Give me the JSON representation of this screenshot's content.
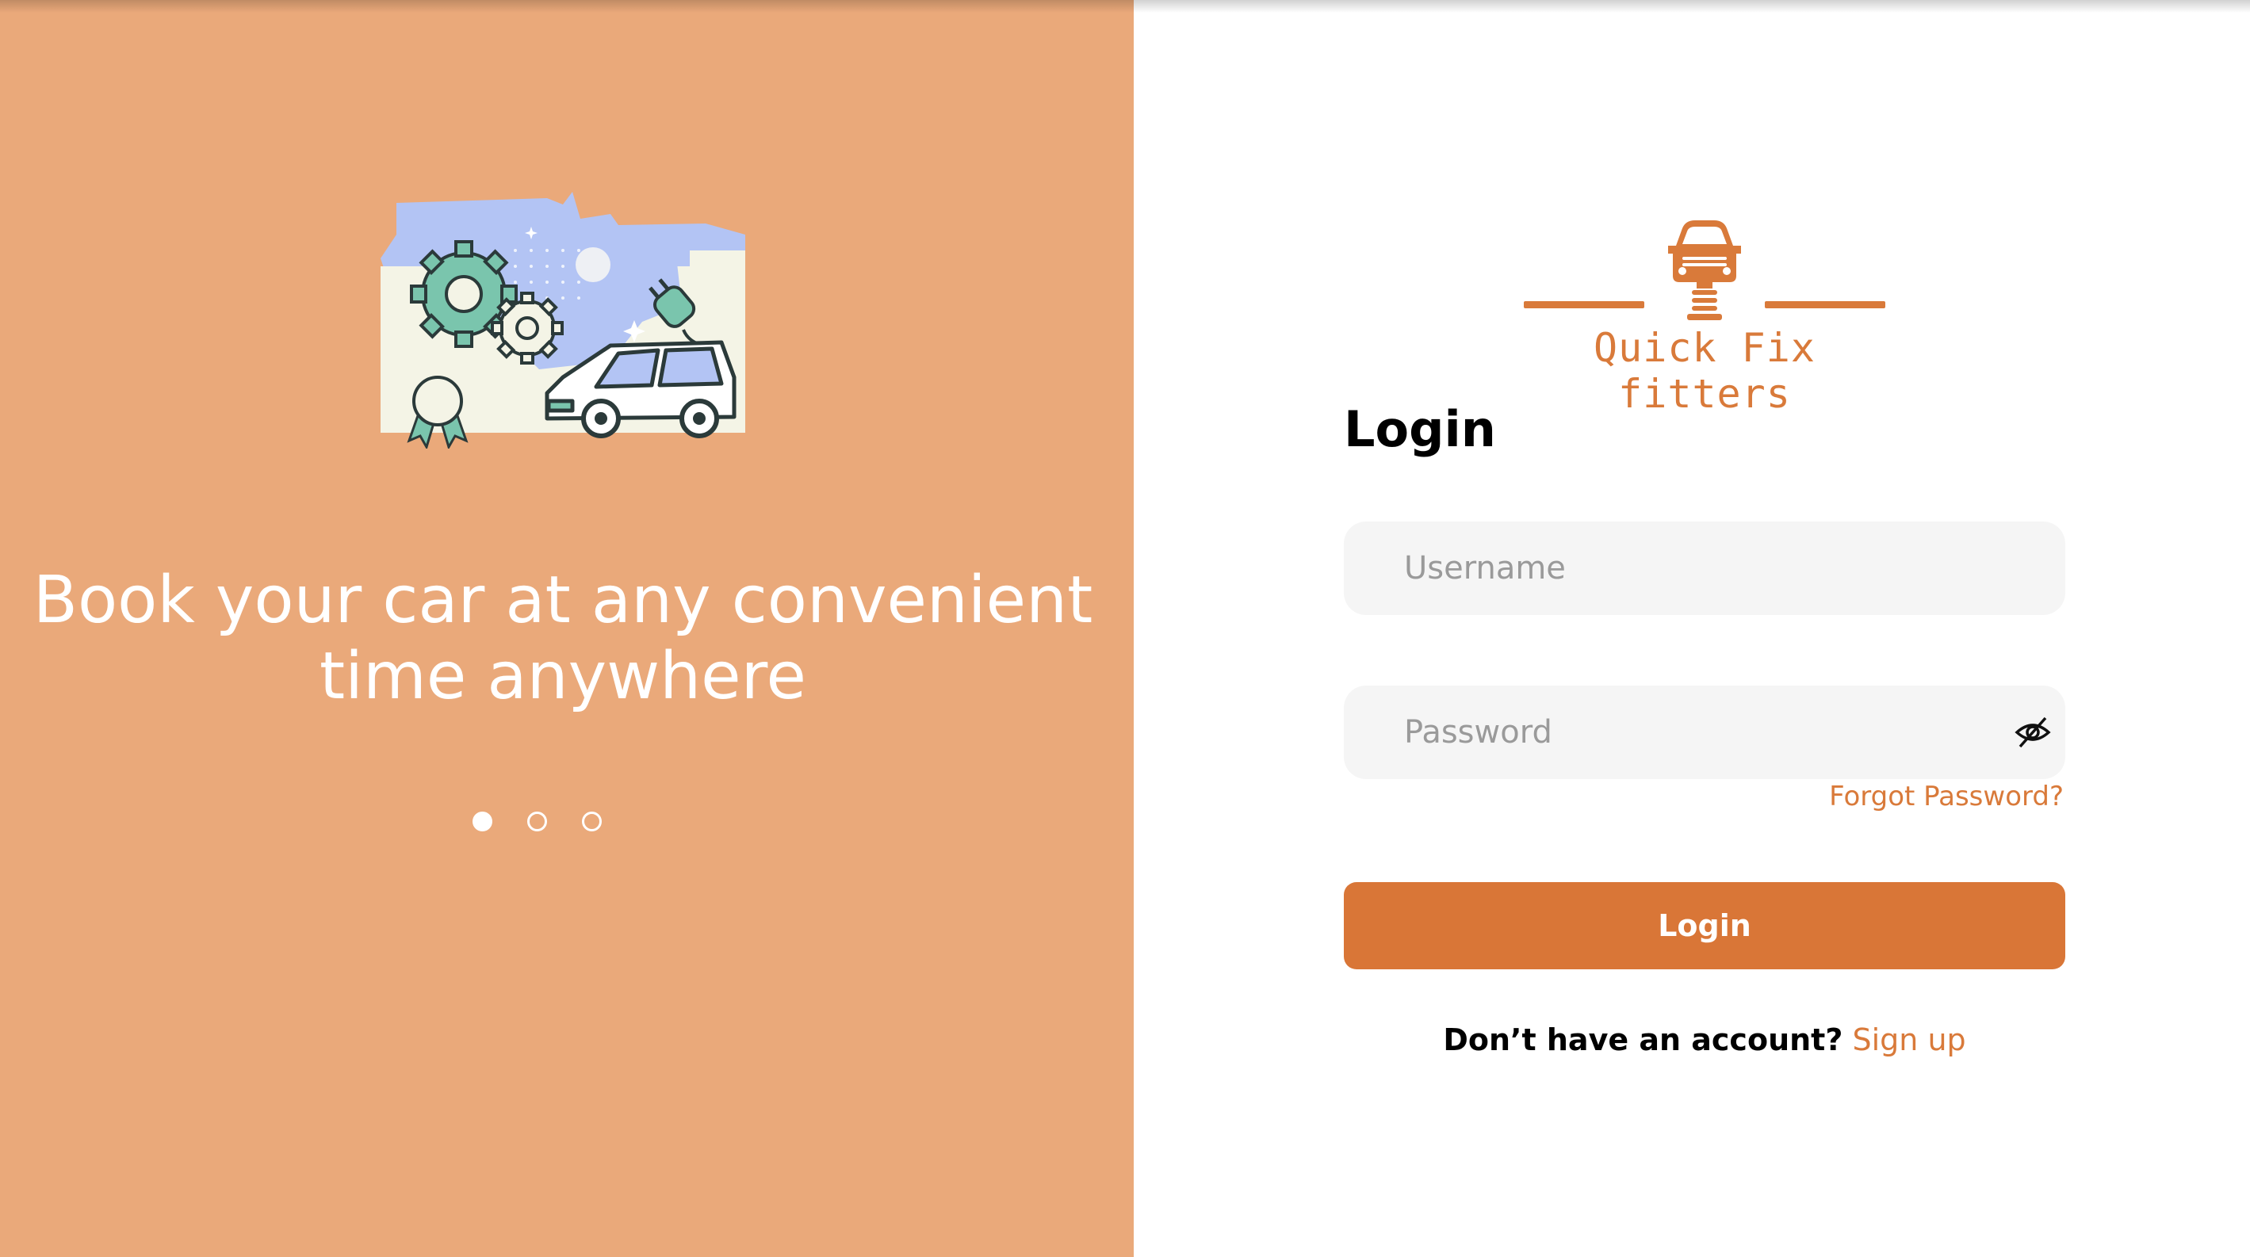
{
  "hero": {
    "tagline_line1": "Book your car at any convenient",
    "tagline_line2": "time anywhere",
    "carousel": {
      "total": 3,
      "active_index": 0
    }
  },
  "brand": {
    "name": "Quick Fix fitters",
    "logo_icon": "car-on-lift-icon",
    "color": "#d97a3a"
  },
  "login": {
    "title": "Login",
    "username_placeholder": "Username",
    "password_placeholder": "Password",
    "password_toggle_icon": "eye-slash-icon",
    "forgot_password": "Forgot Password?",
    "submit_label": "Login",
    "signup_prompt": "Don’t have an account?",
    "signup_link": "Sign up"
  },
  "colors": {
    "left_panel": "#eaa97a",
    "accent": "#d97637",
    "field_bg": "#f5f5f5"
  }
}
